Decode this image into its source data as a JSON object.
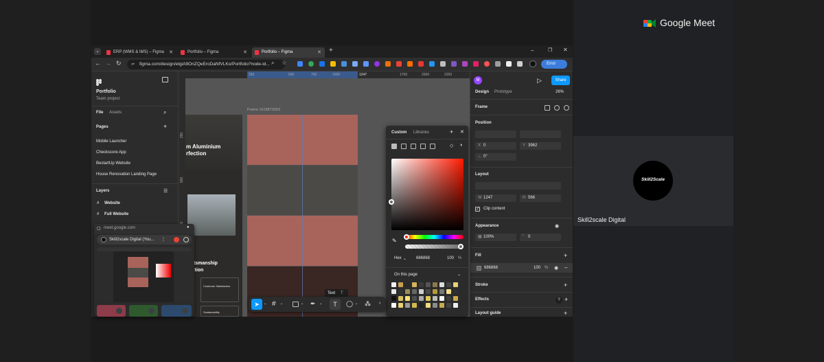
{
  "meet": {
    "brand": "Google Meet",
    "participant_name": "Skill2scale Digital",
    "avatar_text": "Skill2Scale"
  },
  "browser": {
    "tabs": [
      {
        "label": "ERP (WMS & IMS) – Figma",
        "active": false
      },
      {
        "label": "Portfolio – Figma",
        "active": false
      },
      {
        "label": "Portfolio – Figma",
        "active": true
      }
    ],
    "url": "figma.com/design/etgiA9OnZQeEroDaNfVLKo/Portfolio?node-id...",
    "error_label": "Error"
  },
  "figma_left": {
    "file_name": "Portfolio",
    "team": "Team project",
    "tab_file": "File",
    "tab_assets": "Assets",
    "pages_title": "Pages",
    "pages": [
      "Mobile Launcher",
      "Checkscore App",
      "BestartUp Website",
      "House Renovation Landing Page"
    ],
    "layers_title": "Layers",
    "layers": [
      "Website",
      "Full Website"
    ]
  },
  "canvas": {
    "frame_label": "Frame 1618873053",
    "ruler_ticks": [
      "250",
      "500",
      "750",
      "1000",
      "1247",
      "1750",
      "2000",
      "2250"
    ],
    "ruler_v": [
      "250",
      "500",
      "750"
    ],
    "headline1": "m Aluminium",
    "headline2": "rfection",
    "headline3": "raftsmanship",
    "headline4": "olution",
    "card_label": "Customer Satisfaction",
    "card_label2": "Sustainability",
    "stripe_colors": [
      "#a8635b",
      "#4b4a46",
      "#a8635b",
      "#3a2622"
    ],
    "tooltip": "Text",
    "tooltip_key": "T"
  },
  "color_picker": {
    "tab_custom": "Custom",
    "tab_libraries": "Libraries",
    "format": "Hex",
    "hex_value": "686868",
    "opacity": "100",
    "opacity_unit": "%",
    "swatches_title": "On this page"
  },
  "figma_right": {
    "tab_design": "Design",
    "tab_prototype": "Prototype",
    "zoom": "26%",
    "share_label": "Share",
    "avatar_letter": "M",
    "frame_label": "Frame",
    "position_title": "Position",
    "x_label": "X",
    "x_value": "0",
    "y_label": "Y",
    "y_value": "3962",
    "rot_value": "0°",
    "layout_title": "Layout",
    "w_label": "W",
    "w_value": "1247",
    "h_label": "H",
    "h_value": "566",
    "clip_label": "Clip content",
    "appearance_title": "Appearance",
    "opacity_value": "100%",
    "radius_value": "0",
    "fill_title": "Fill",
    "fill_hex": "686868",
    "fill_opacity": "100",
    "fill_unit": "%",
    "stroke_title": "Stroke",
    "effects_title": "Effects",
    "layout_guide_title": "Layout guide",
    "help": "?"
  },
  "pip": {
    "url": "meet.google.com",
    "title": "Skill2scale Digital (You..."
  },
  "colors": {
    "accent": "#0d99ff",
    "meet_bg": "#202124",
    "figma_panel": "#2c2c2c"
  }
}
